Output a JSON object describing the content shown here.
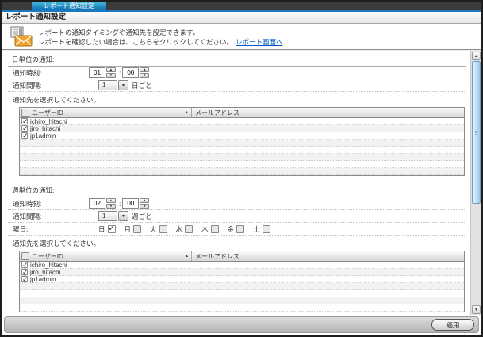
{
  "window": {
    "tab_title": "レポート通知設定",
    "page_title": "レポート通知設定"
  },
  "intro": {
    "line1": "レポートの通知タイミングや通知先を設定できます。",
    "line2": "レポートを確認したい場合は、こちらをクリックしてください。",
    "link_label": "レポート画面へ"
  },
  "table": {
    "columns": [
      "ユーザーID",
      "メールアドレス"
    ],
    "sort_icon": "▲"
  },
  "users": [
    {
      "id": "ichiro_hitachi",
      "email": "",
      "checked": true
    },
    {
      "id": "jiro_hitachi",
      "email": "",
      "checked": true
    },
    {
      "id": "jp1admin",
      "email": "",
      "checked": true
    }
  ],
  "daily": {
    "section_title": "日単位の通知:",
    "time_label": "通知時刻:",
    "hour": "01",
    "time_separator": ":",
    "minute": "00",
    "interval_label": "通知間隔:",
    "interval_value": "1",
    "interval_unit": "日ごと",
    "select_label": "通知先を選択してください。",
    "empty_rows": 5
  },
  "weekly": {
    "section_title": "週単位の通知:",
    "time_label": "通知時刻:",
    "hour": "02",
    "time_separator": ":",
    "minute": "00",
    "interval_label": "通知間隔:",
    "interval_value": "1",
    "interval_unit": "週ごと",
    "weekday_label": "曜日:",
    "weekdays": [
      {
        "label": "日",
        "checked": true
      },
      {
        "label": "月",
        "checked": false
      },
      {
        "label": "火",
        "checked": false
      },
      {
        "label": "水",
        "checked": false
      },
      {
        "label": "木",
        "checked": false
      },
      {
        "label": "金",
        "checked": false
      },
      {
        "label": "土",
        "checked": false
      }
    ],
    "select_label": "通知先を選択してください。",
    "empty_rows": 4
  },
  "footer": {
    "apply_label": "適用"
  },
  "colors": {
    "tab_gradient_top": "#46bcdc",
    "tab_gradient_bottom": "#0e6cb2",
    "accent_line": "#1878c0",
    "link": "#0058c8",
    "scrollbar_thumb": "#9cc9ea",
    "envelope": "#f0a430"
  }
}
